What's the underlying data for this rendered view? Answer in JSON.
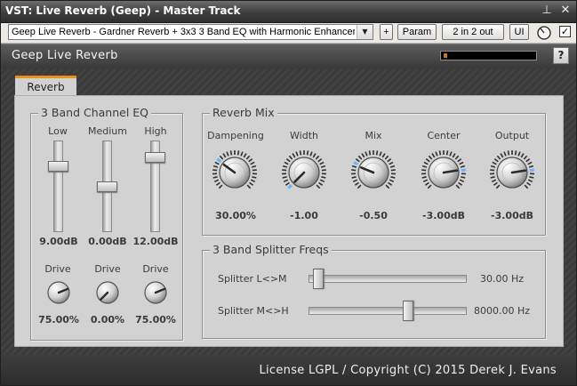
{
  "window": {
    "title": "VST: Live Reverb (Geep) - Master Track",
    "pin_symbol": "⊥",
    "close_symbol": "✕"
  },
  "toolbar": {
    "preset": "Geep Live Reverb - Gardner Reverb + 3x3 3 Band EQ with Harmonic Enhancement",
    "add_label": "+",
    "param_label": "Param",
    "routing_label": "2 in 2 out",
    "ui_label": "UI",
    "bypass_checked": "✓"
  },
  "header": {
    "plugin_name": "Geep Live Reverb",
    "meter_level": 0.04,
    "help_label": "?",
    "accent": "#c87818"
  },
  "tabs": [
    {
      "label": "Reverb",
      "active": true,
      "accent": "#e8901c"
    }
  ],
  "eq": {
    "title": "3 Band Channel EQ",
    "bands": [
      {
        "label": "Low",
        "value": "9.00dB",
        "level": 0.75,
        "drive_label": "Drive",
        "drive": "75.00%",
        "drive_level": 0.75
      },
      {
        "label": "Medium",
        "value": "0.00dB",
        "level": 0.5,
        "drive_label": "Drive",
        "drive": "0.00%",
        "drive_level": 0.0
      },
      {
        "label": "High",
        "value": "12.00dB",
        "level": 0.86,
        "drive_label": "Drive",
        "drive": "75.00%",
        "drive_level": 0.75
      }
    ]
  },
  "reverb": {
    "title": "Reverb Mix",
    "knobs": [
      {
        "label": "Dampening",
        "value": "30.00%",
        "level": 0.3
      },
      {
        "label": "Width",
        "value": "-1.00",
        "level": 0.0
      },
      {
        "label": "Mix",
        "value": "-0.50",
        "level": 0.25
      },
      {
        "label": "Center",
        "value": "-3.00dB",
        "level": 0.8
      },
      {
        "label": "Output",
        "value": "-3.00dB",
        "level": 0.8
      }
    ]
  },
  "splitter": {
    "title": "3 Band Splitter Freqs",
    "sliders": [
      {
        "label": "Splitter L<>M",
        "value": "30.00 Hz",
        "level": 0.03
      },
      {
        "label": "Splitter M<>H",
        "value": "8000.00 Hz",
        "level": 0.64
      }
    ]
  },
  "footer": {
    "license": "License LGPL / Copyright (C) 2015 Derek J. Evans"
  }
}
